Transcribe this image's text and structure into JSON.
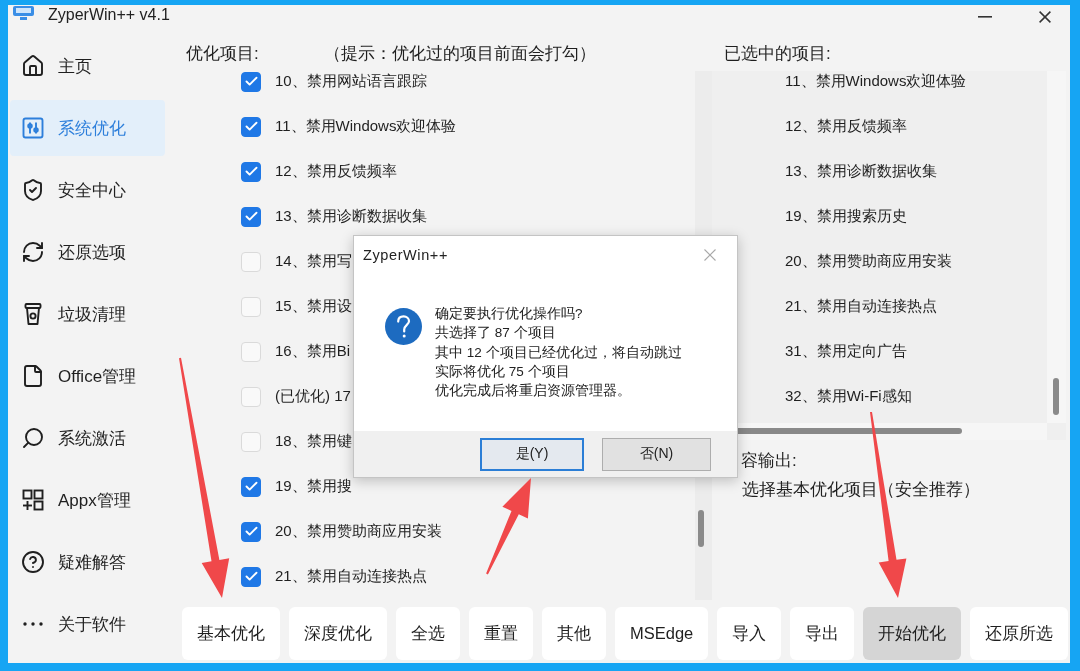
{
  "window": {
    "title": "ZyperWin++ v4.1"
  },
  "sidebar": {
    "items": [
      {
        "label": "主页",
        "selected": false
      },
      {
        "label": "系统优化",
        "selected": true
      },
      {
        "label": "安全中心",
        "selected": false
      },
      {
        "label": "还原选项",
        "selected": false
      },
      {
        "label": "垃圾清理",
        "selected": false
      },
      {
        "label": "Office管理",
        "selected": false
      },
      {
        "label": "系统激活",
        "selected": false
      },
      {
        "label": "Appx管理",
        "selected": false
      },
      {
        "label": "疑难解答",
        "selected": false
      },
      {
        "label": "关于软件",
        "selected": false
      }
    ]
  },
  "optimize_list": {
    "title": "优化项目:",
    "hint": "（提示：优化过的项目前面会打勾）",
    "items": [
      {
        "label": "10、禁用网站语言跟踪",
        "checked": true
      },
      {
        "label": "11、禁用Windows欢迎体验",
        "checked": true
      },
      {
        "label": "12、禁用反馈频率",
        "checked": true
      },
      {
        "label": "13、禁用诊断数据收集",
        "checked": true
      },
      {
        "label": "14、禁用写",
        "checked": false
      },
      {
        "label": "15、禁用设",
        "checked": false
      },
      {
        "label": "16、禁用Bi",
        "checked": false
      },
      {
        "label": "(已优化) 17",
        "checked": false
      },
      {
        "label": "18、禁用键",
        "checked": false
      },
      {
        "label": "19、禁用搜",
        "checked": true
      },
      {
        "label": "20、禁用赞助商应用安装",
        "checked": true
      },
      {
        "label": "21、禁用自动连接热点",
        "checked": true
      }
    ]
  },
  "selected_list": {
    "title": "已选中的项目:",
    "items": [
      "11、禁用Windows欢迎体验",
      "12、禁用反馈频率",
      "13、禁用诊断数据收集",
      "19、禁用搜索历史",
      "20、禁用赞助商应用安装",
      "21、禁用自动连接热点",
      "31、禁用定向广告",
      "32、禁用Wi-Fi感知"
    ]
  },
  "output": {
    "title": "容输出:",
    "text": "选择基本优化项目（安全推荐）"
  },
  "toolbar": {
    "buttons": [
      {
        "label": "基本优化",
        "highlighted": false
      },
      {
        "label": "深度优化",
        "highlighted": false
      },
      {
        "label": "全选",
        "highlighted": false
      },
      {
        "label": "重置",
        "highlighted": false
      },
      {
        "label": "其他",
        "highlighted": false
      },
      {
        "label": "MSEdge",
        "highlighted": false
      },
      {
        "label": "导入",
        "highlighted": false
      },
      {
        "label": "导出",
        "highlighted": false
      },
      {
        "label": "开始优化",
        "highlighted": true
      },
      {
        "label": "还原所选",
        "highlighted": false
      }
    ]
  },
  "dialog": {
    "title": "ZyperWin++",
    "lines": [
      "确定要执行优化操作吗?",
      "共选择了 87 个项目",
      "其中 12 个项目已经优化过，将自动跳过",
      "实际将优化 75 个项目",
      "优化完成后将重启资源管理器。"
    ],
    "buttons": [
      {
        "label": "是(Y)",
        "default": true
      },
      {
        "label": "否(N)",
        "default": false
      }
    ]
  }
}
